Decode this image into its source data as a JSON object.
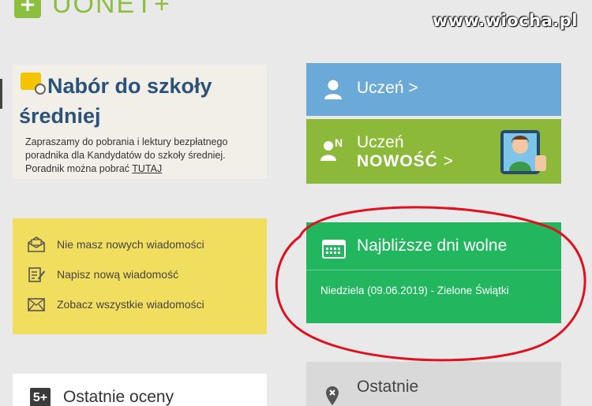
{
  "header": {
    "logo_symbol": "+",
    "logo_text": "UONET+",
    "watermark": "www.wiocha.pl"
  },
  "recruitment": {
    "title": "Nabór do szkoły średniej",
    "body": "Zapraszamy do pobrania i lektury bezpłatnego poradnika dla Kandydatów do szkoły średniej. Poradnik można pobrać",
    "link": "TUTAJ"
  },
  "messages": {
    "items": [
      {
        "icon": "envelope-open-icon",
        "label": "Nie masz nowych wiadomości"
      },
      {
        "icon": "compose-icon",
        "label": "Napisz nową wiadomość"
      },
      {
        "icon": "envelope-closed-icon",
        "label": "Zobacz wszystkie wiadomości"
      }
    ]
  },
  "grades": {
    "badge": "5+",
    "title": "Ostatnie oceny"
  },
  "tiles": {
    "student": {
      "label": "Uczeń >",
      "color": "#6aa9d8"
    },
    "student_new": {
      "label1": "Uczeń",
      "label2": "NOWOŚĆ",
      "arrow": ">",
      "icon_letter": "N",
      "color": "#8cb939"
    },
    "holidays": {
      "title": "Najbliższe dni wolne",
      "entry": "Niedziela (09.06.2019) - Zielone Świątki",
      "color": "#22b65f"
    },
    "latest": {
      "label": "Ostatnie",
      "label2": "..."
    }
  },
  "annotation": {
    "color": "#e0101f"
  }
}
